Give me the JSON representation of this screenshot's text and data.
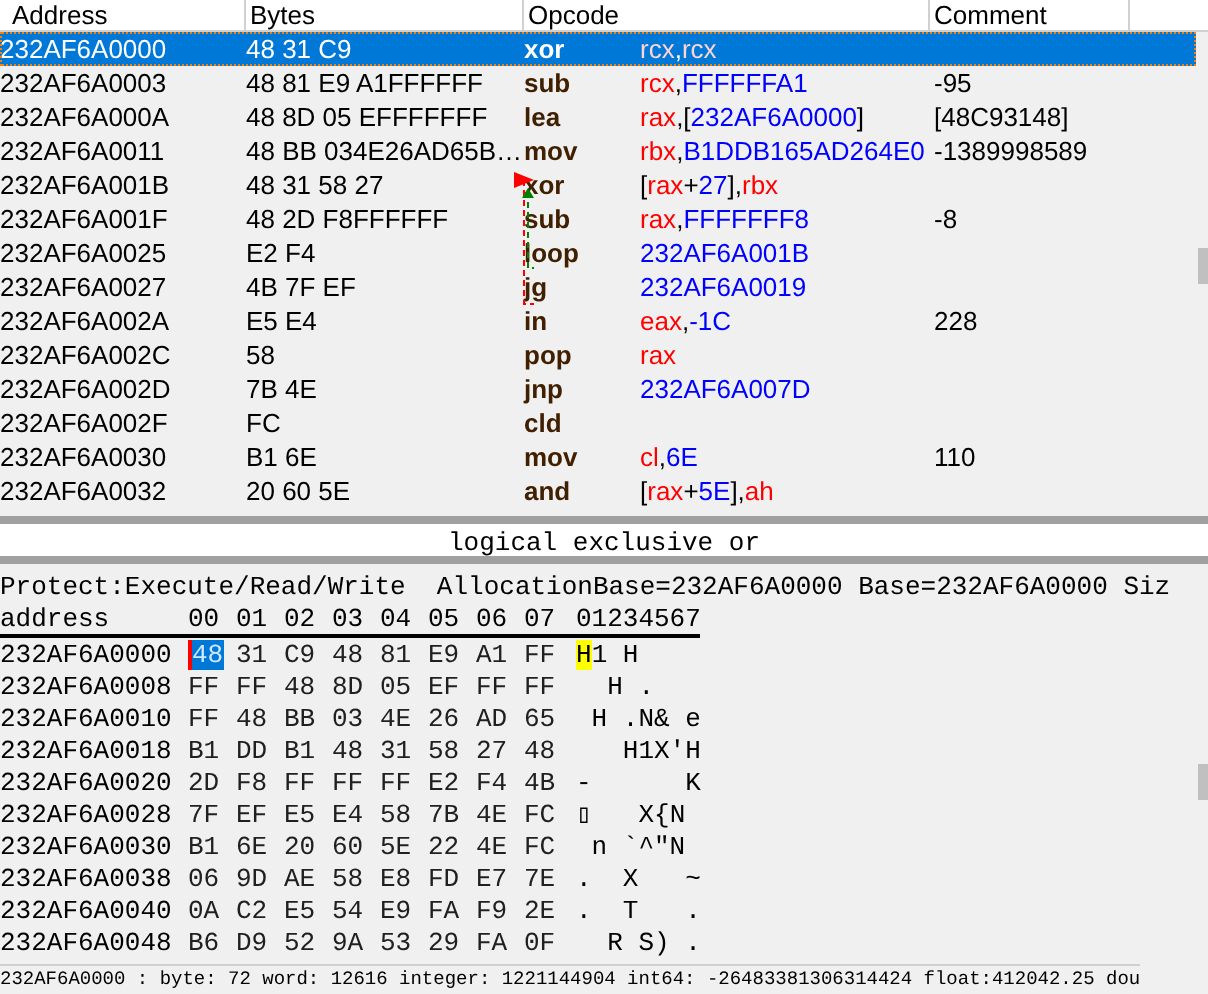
{
  "disassembly": {
    "columns": [
      "Address",
      "Bytes",
      "Opcode",
      "Comment"
    ],
    "rows": [
      {
        "address": "232AF6A0000",
        "bytes": "48 31 C9",
        "mnemonic": "xor",
        "operands": [
          {
            "kind": "reg",
            "text": "rcx"
          },
          {
            "kind": "plain",
            "text": ","
          },
          {
            "kind": "reg",
            "text": "rcx"
          }
        ],
        "comment": "",
        "selected": true
      },
      {
        "address": "232AF6A0003",
        "bytes": "48 81 E9 A1FFFFFF",
        "mnemonic": "sub",
        "operands": [
          {
            "kind": "reg",
            "text": "rcx"
          },
          {
            "kind": "plain",
            "text": ","
          },
          {
            "kind": "num",
            "text": "FFFFFFA1"
          }
        ],
        "comment": "-95",
        "selected": false
      },
      {
        "address": "232AF6A000A",
        "bytes": "48 8D 05 EFFFFFFF",
        "mnemonic": "lea",
        "operands": [
          {
            "kind": "reg",
            "text": "rax"
          },
          {
            "kind": "plain",
            "text": ",["
          },
          {
            "kind": "num",
            "text": "232AF6A0000"
          },
          {
            "kind": "plain",
            "text": "]"
          }
        ],
        "comment": "[48C93148]",
        "selected": false
      },
      {
        "address": "232AF6A0011",
        "bytes": "48 BB 034E26AD65B…",
        "mnemonic": "mov",
        "operands": [
          {
            "kind": "reg",
            "text": "rbx"
          },
          {
            "kind": "plain",
            "text": ","
          },
          {
            "kind": "num",
            "text": "B1DDB165AD264E0"
          }
        ],
        "comment": "-1389998589",
        "selected": false
      },
      {
        "address": "232AF6A001B",
        "bytes": "48 31 58 27",
        "mnemonic": "xor",
        "operands": [
          {
            "kind": "plain",
            "text": "["
          },
          {
            "kind": "reg",
            "text": "rax"
          },
          {
            "kind": "plain",
            "text": "+"
          },
          {
            "kind": "num",
            "text": "27"
          },
          {
            "kind": "plain",
            "text": "],"
          },
          {
            "kind": "reg",
            "text": "rbx"
          }
        ],
        "comment": "",
        "selected": false
      },
      {
        "address": "232AF6A001F",
        "bytes": "48 2D F8FFFFFF",
        "mnemonic": "sub",
        "operands": [
          {
            "kind": "reg",
            "text": "rax"
          },
          {
            "kind": "plain",
            "text": ","
          },
          {
            "kind": "num",
            "text": "FFFFFFF8"
          }
        ],
        "comment": "-8",
        "selected": false
      },
      {
        "address": "232AF6A0025",
        "bytes": "E2 F4",
        "mnemonic": "loop",
        "operands": [
          {
            "kind": "num",
            "text": "232AF6A001B"
          }
        ],
        "comment": "",
        "selected": false
      },
      {
        "address": "232AF6A0027",
        "bytes": "4B 7F EF",
        "mnemonic": "jg",
        "operands": [
          {
            "kind": "num",
            "text": "232AF6A0019"
          }
        ],
        "comment": "",
        "selected": false
      },
      {
        "address": "232AF6A002A",
        "bytes": "E5 E4",
        "mnemonic": "in",
        "operands": [
          {
            "kind": "reg",
            "text": "eax"
          },
          {
            "kind": "plain",
            "text": ","
          },
          {
            "kind": "num",
            "text": "-1C"
          }
        ],
        "comment": "228",
        "selected": false
      },
      {
        "address": "232AF6A002C",
        "bytes": "58",
        "mnemonic": "pop",
        "operands": [
          {
            "kind": "reg",
            "text": "rax"
          }
        ],
        "comment": "",
        "selected": false
      },
      {
        "address": "232AF6A002D",
        "bytes": "7B 4E",
        "mnemonic": "jnp",
        "operands": [
          {
            "kind": "num",
            "text": "232AF6A007D"
          }
        ],
        "comment": "",
        "selected": false
      },
      {
        "address": "232AF6A002F",
        "bytes": "FC",
        "mnemonic": "cld",
        "operands": [],
        "comment": "",
        "selected": false
      },
      {
        "address": "232AF6A0030",
        "bytes": "B1 6E",
        "mnemonic": "mov",
        "operands": [
          {
            "kind": "reg",
            "text": "cl"
          },
          {
            "kind": "plain",
            "text": ","
          },
          {
            "kind": "num",
            "text": "6E"
          }
        ],
        "comment": "110",
        "selected": false
      },
      {
        "address": "232AF6A0032",
        "bytes": "20 60 5E",
        "mnemonic": "and",
        "operands": [
          {
            "kind": "plain",
            "text": "["
          },
          {
            "kind": "reg",
            "text": "rax"
          },
          {
            "kind": "plain",
            "text": "+"
          },
          {
            "kind": "num",
            "text": "5E"
          },
          {
            "kind": "plain",
            "text": "],"
          },
          {
            "kind": "reg",
            "text": "ah"
          }
        ],
        "comment": "",
        "selected": false
      }
    ]
  },
  "description": "logical exclusive or",
  "hex": {
    "info": "Protect:Execute/Read/Write  AllocationBase=232AF6A0000 Base=232AF6A0000 Siz",
    "address_header": "address",
    "offsets": [
      "00",
      "01",
      "02",
      "03",
      "04",
      "05",
      "06",
      "07"
    ],
    "ascii_header": "01234567",
    "rows": [
      {
        "address": "232AF6A0000",
        "bytes": [
          "48",
          "31",
          "C9",
          "48",
          "81",
          "E9",
          "A1",
          "FF"
        ],
        "ascii": "H1 H    "
      },
      {
        "address": "232AF6A0008",
        "bytes": [
          "FF",
          "FF",
          "48",
          "8D",
          "05",
          "EF",
          "FF",
          "FF"
        ],
        "ascii": "  H .   "
      },
      {
        "address": "232AF6A0010",
        "bytes": [
          "FF",
          "48",
          "BB",
          "03",
          "4E",
          "26",
          "AD",
          "65"
        ],
        "ascii": " H .N& e"
      },
      {
        "address": "232AF6A0018",
        "bytes": [
          "B1",
          "DD",
          "B1",
          "48",
          "31",
          "58",
          "27",
          "48"
        ],
        "ascii": "   H1X'H"
      },
      {
        "address": "232AF6A0020",
        "bytes": [
          "2D",
          "F8",
          "FF",
          "FF",
          "FF",
          "E2",
          "F4",
          "4B"
        ],
        "ascii": "-      K"
      },
      {
        "address": "232AF6A0028",
        "bytes": [
          "7F",
          "EF",
          "E5",
          "E4",
          "58",
          "7B",
          "4E",
          "FC"
        ],
        "ascii": "▯   X{N "
      },
      {
        "address": "232AF6A0030",
        "bytes": [
          "B1",
          "6E",
          "20",
          "60",
          "5E",
          "22",
          "4E",
          "FC"
        ],
        "ascii": " n `^\"N "
      },
      {
        "address": "232AF6A0038",
        "bytes": [
          "06",
          "9D",
          "AE",
          "58",
          "E8",
          "FD",
          "E7",
          "7E"
        ],
        "ascii": ".  X   ~"
      },
      {
        "address": "232AF6A0040",
        "bytes": [
          "0A",
          "C2",
          "E5",
          "54",
          "E9",
          "FA",
          "F9",
          "2E"
        ],
        "ascii": ".  T   ."
      },
      {
        "address": "232AF6A0048",
        "bytes": [
          "B6",
          "D9",
          "52",
          "9A",
          "53",
          "29",
          "FA",
          "0F"
        ],
        "ascii": "  R S) ."
      }
    ]
  },
  "status": "232AF6A0000 : byte: 72 word: 12616 integer: 1221144904 int64: -26483381306314424 float:412042.25 dou"
}
